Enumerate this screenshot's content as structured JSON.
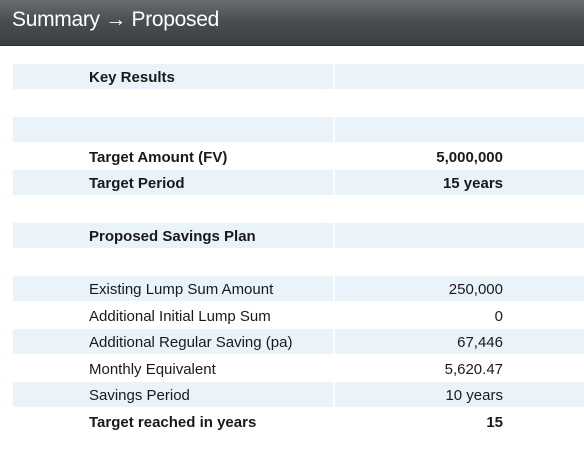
{
  "header": {
    "title": "Summary → Proposed"
  },
  "rows": [
    {
      "label": "Key Results",
      "value": "",
      "bold": true,
      "shade": true
    },
    {
      "label": "",
      "value": "",
      "bold": false,
      "shade": false
    },
    {
      "label": "",
      "value": "",
      "bold": false,
      "shade": true
    },
    {
      "label": "Target Amount (FV)",
      "value": "5,000,000",
      "bold": true,
      "shade": false
    },
    {
      "label": "Target Period",
      "value": "15 years",
      "bold": true,
      "shade": true
    },
    {
      "label": "",
      "value": "",
      "bold": false,
      "shade": false
    },
    {
      "label": "Proposed Savings Plan",
      "value": "",
      "bold": true,
      "shade": true
    },
    {
      "label": "",
      "value": "",
      "bold": false,
      "shade": false
    },
    {
      "label": "Existing Lump Sum Amount",
      "value": "250,000",
      "bold": false,
      "shade": true
    },
    {
      "label": "Additional Initial Lump Sum",
      "value": "0",
      "bold": false,
      "shade": false
    },
    {
      "label": "Additional Regular Saving (pa)",
      "value": "67,446",
      "bold": false,
      "shade": true
    },
    {
      "label": "Monthly Equivalent",
      "value": "5,620.47",
      "bold": false,
      "shade": false
    },
    {
      "label": "Savings Period",
      "value": "10 years",
      "bold": false,
      "shade": true
    },
    {
      "label": "Target reached in years",
      "value": "15",
      "bold": true,
      "shade": false
    }
  ]
}
